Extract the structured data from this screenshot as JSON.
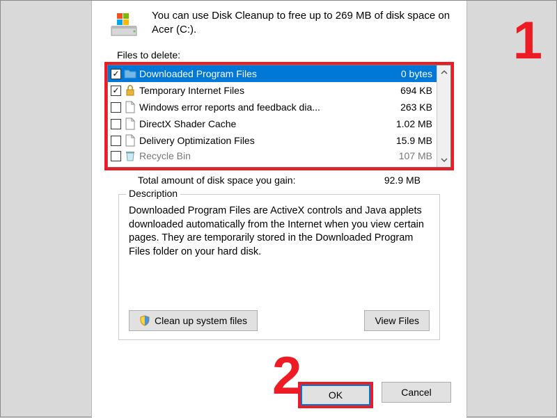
{
  "summary": "You can use Disk Cleanup to free up to 269 MB of disk space on Acer (C:).",
  "files_to_delete_label": "Files to delete:",
  "rows": {
    "0": {
      "name": "Downloaded Program Files",
      "size": "0 bytes"
    },
    "1": {
      "name": "Temporary Internet Files",
      "size": "694 KB"
    },
    "2": {
      "name": "Windows error reports and feedback dia...",
      "size": "263 KB"
    },
    "3": {
      "name": "DirectX Shader Cache",
      "size": "1.02 MB"
    },
    "4": {
      "name": "Delivery Optimization Files",
      "size": "15.9 MB"
    },
    "5": {
      "name": "Recycle Bin",
      "size": "107 MB"
    }
  },
  "total": {
    "label": "Total amount of disk space you gain:",
    "value": "92.9 MB"
  },
  "group": {
    "title": "Description",
    "text": "Downloaded Program Files are ActiveX controls and Java applets downloaded automatically from the Internet when you view certain pages. They are temporarily stored in the Downloaded Program Files folder on your hard disk."
  },
  "buttons": {
    "cleanup": "Clean up system files",
    "view": "View Files",
    "ok": "OK",
    "cancel": "Cancel"
  },
  "annotations": {
    "one": "1",
    "two": "2"
  }
}
